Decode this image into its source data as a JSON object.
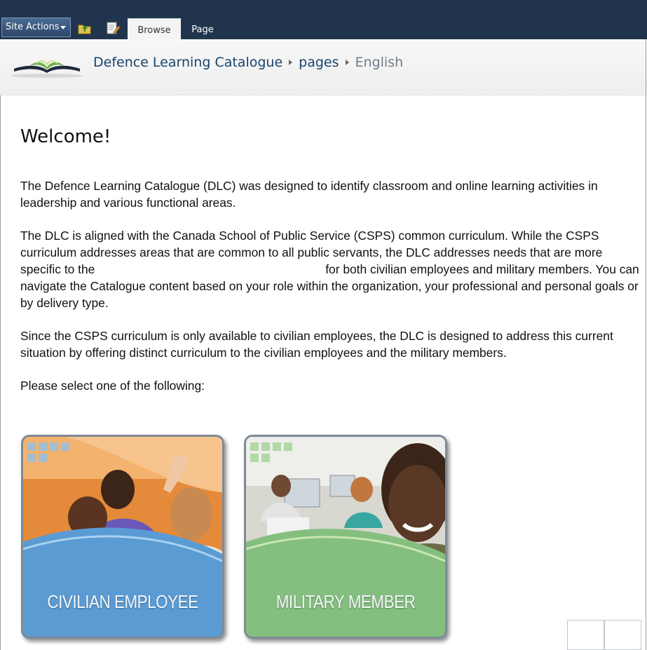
{
  "ribbon": {
    "site_actions_label": "Site Actions",
    "icons": [
      "navigate-up-icon",
      "edit-page-icon"
    ],
    "tabs": [
      {
        "label": "Browse",
        "selected": true
      },
      {
        "label": "Page",
        "selected": false
      }
    ]
  },
  "breadcrumb": {
    "items": [
      "Defence Learning Catalogue",
      "pages",
      "English"
    ]
  },
  "main": {
    "title": "Welcome!",
    "paragraphs": [
      "The Defence Learning Catalogue (DLC) was designed to identify classroom and online learning activities in leadership and various functional areas.",
      "The DLC is aligned with the Canada School of Public Service (CSPS) common curriculum.  While the CSPS curriculum addresses areas that are common to all public servants, the DLC addresses needs that are more specific to the",
      "for both civilian employees and military members. You can navigate the Catalogue content based on your role within the organization, your professional and personal goals or by delivery type.",
      "Since the CSPS curriculum is only available to civilian employees, the DLC is designed to address this current situation by offering distinct curriculum to the civilian employees and the military members.",
      "Please select one of the following:"
    ]
  },
  "tiles": [
    {
      "label": "CIVILIAN EMPLOYEE"
    },
    {
      "label": "MILITARY MEMBER"
    }
  ],
  "colors": {
    "ribbon_bg": "#21344d",
    "breadcrumb_link": "#17436e",
    "civilian_tile": "#4d8fcb",
    "military_tile": "#86bf80"
  }
}
